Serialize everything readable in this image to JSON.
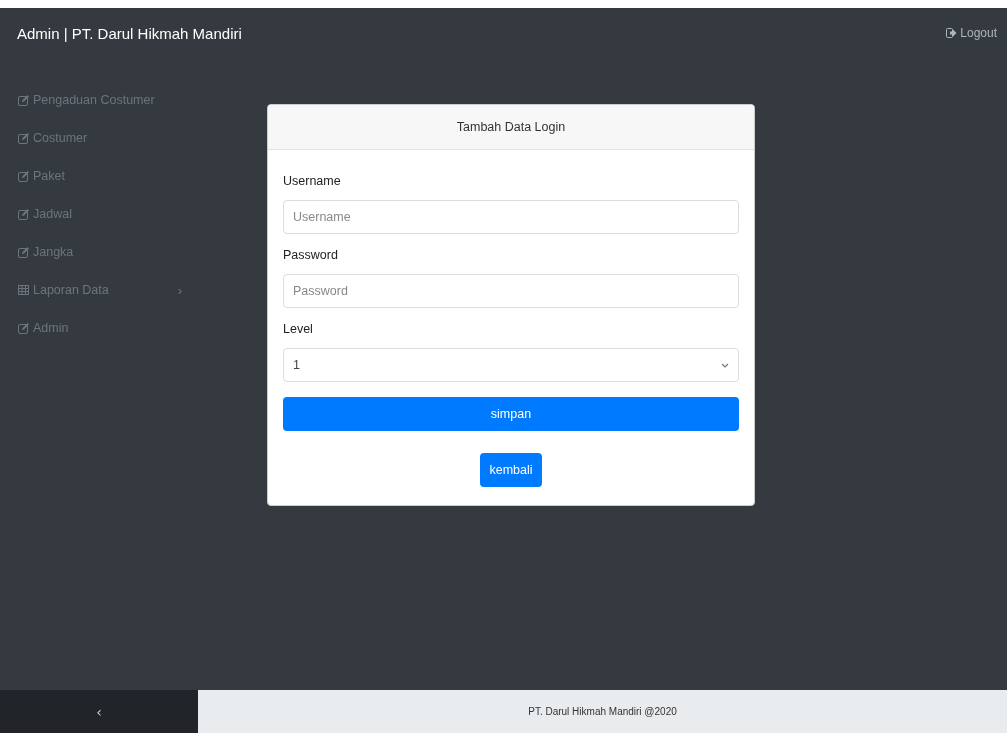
{
  "header": {
    "title": "Admin | PT. Darul Hikmah Mandiri",
    "logout": "Logout"
  },
  "sidebar": {
    "items": [
      {
        "label": "Pengaduan Costumer",
        "kind": "edit"
      },
      {
        "label": "Costumer",
        "kind": "edit"
      },
      {
        "label": "Paket",
        "kind": "edit"
      },
      {
        "label": "Jadwal",
        "kind": "edit"
      },
      {
        "label": "Jangka",
        "kind": "edit"
      },
      {
        "label": "Laporan Data",
        "kind": "table",
        "chevron": "›"
      },
      {
        "label": "Admin",
        "kind": "edit"
      }
    ],
    "collapse": "‹"
  },
  "form": {
    "title": "Tambah Data Login",
    "fields": [
      {
        "label": "Username",
        "kind": "text",
        "placeholder": "Username"
      },
      {
        "label": "Password",
        "kind": "password",
        "placeholder": "Password"
      },
      {
        "label": "Level",
        "kind": "select",
        "value": "1"
      }
    ],
    "submit": "simpan",
    "back": "kembali"
  },
  "footer": {
    "text": "PT. Darul Hikmah Mandiri @2020"
  }
}
